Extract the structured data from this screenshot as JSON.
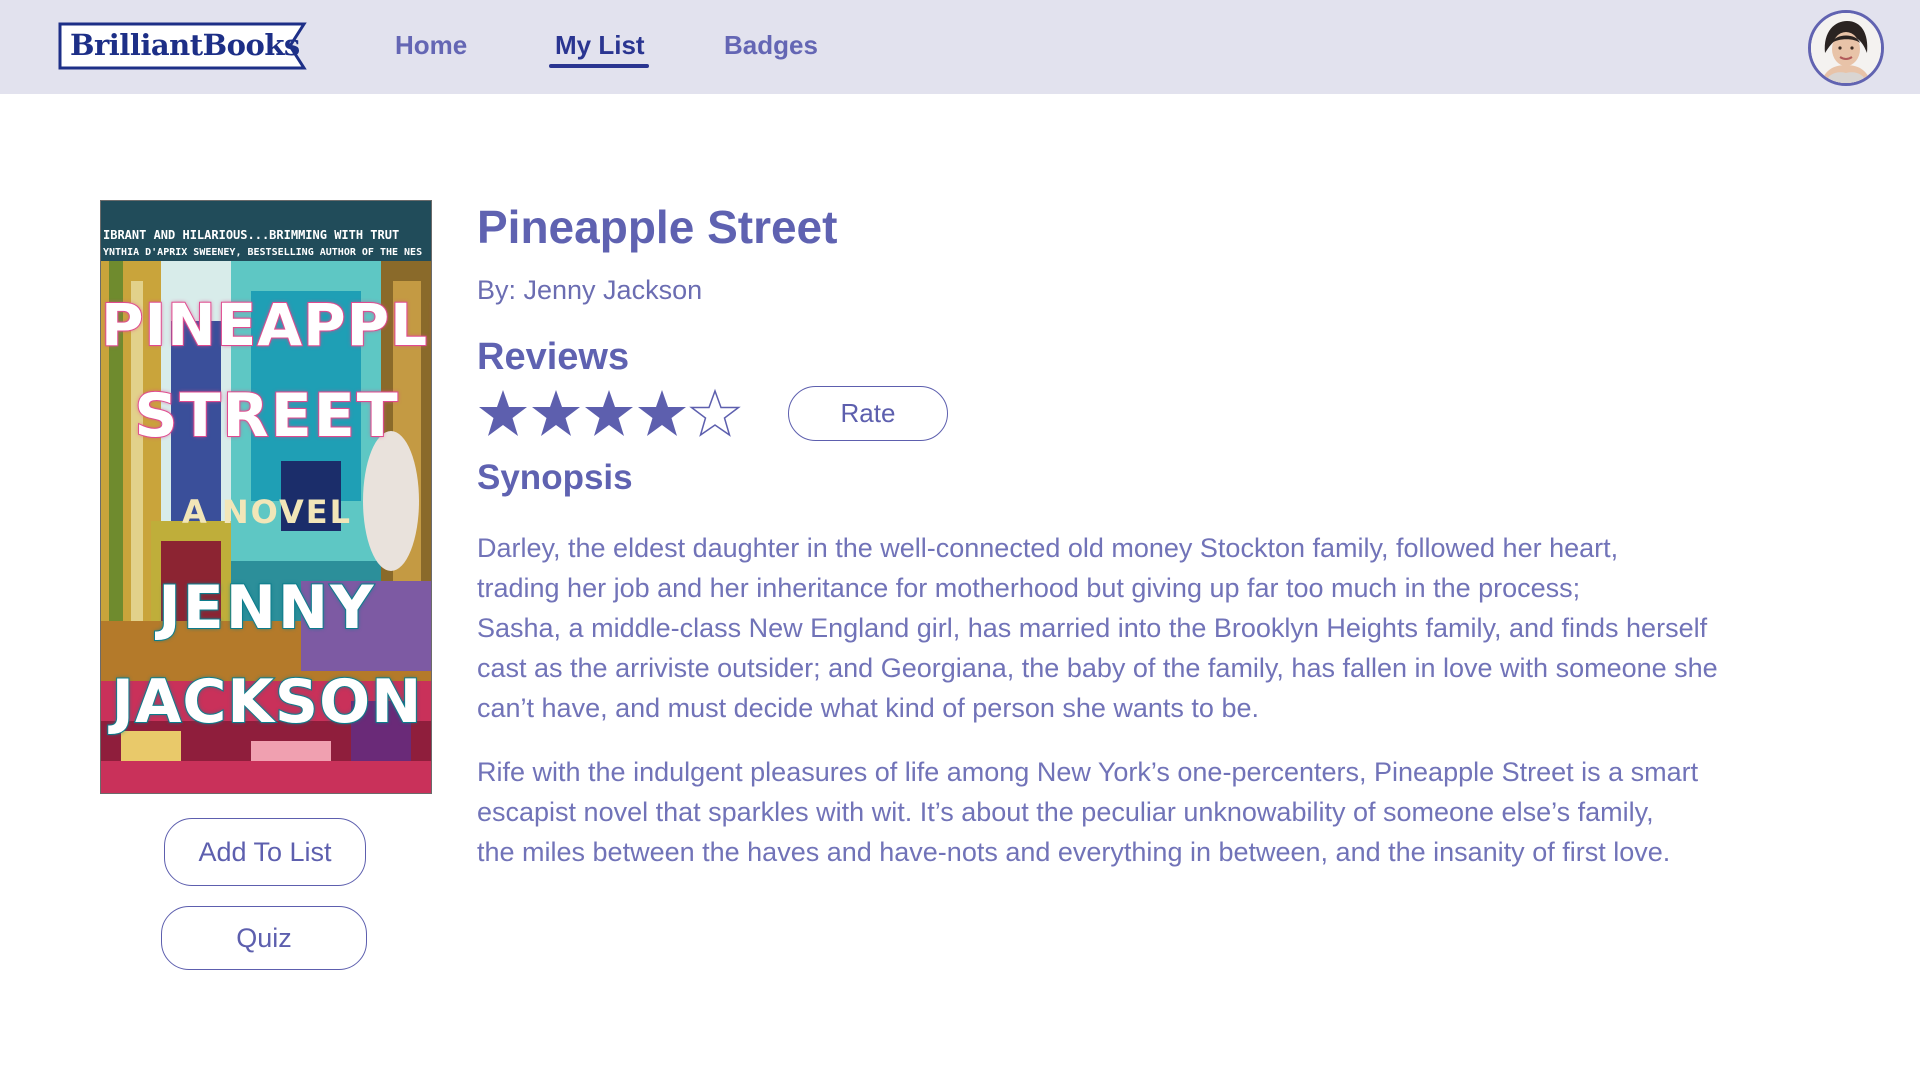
{
  "brand": {
    "name": "BrilliantBooks"
  },
  "nav": {
    "home": "Home",
    "my_list": "My List",
    "badges": "Badges",
    "active": "My List"
  },
  "book": {
    "title": "Pineapple Street",
    "author_line": "By: Jenny Jackson",
    "cover": {
      "tagline_1": "IBRANT AND HILARIOUS...BRIMMING WITH TRUT",
      "tagline_2": "YNTHIA D'APRIX SWEENEY, BESTSELLING AUTHOR OF THE NES",
      "title_1": "PINEAPPLE",
      "title_2": "STREET",
      "subtitle": "A NOVEL",
      "author_1": "JENNY",
      "author_2": "JACKSON"
    }
  },
  "reviews": {
    "heading": "Reviews",
    "rating": 4,
    "max_rating": 5,
    "rate_button": "Rate"
  },
  "synopsis": {
    "heading": "Synopsis",
    "paragraph_1_lines": [
      "Darley, the eldest daughter in the well-connected old money Stockton family, followed her heart,",
      "trading her job and her inheritance for motherhood but giving up far too much in the process;",
      "Sasha, a middle-class New England girl, has married into the Brooklyn Heights family, and finds herself",
      "cast as the arriviste outsider; and Georgiana, the baby of the family, has fallen in love with someone she",
      "can’t have, and must decide what kind of person she wants to be."
    ],
    "paragraph_2_lines": [
      "Rife with the indulgent pleasures of life among New York’s one-percenters, Pineapple Street is a smart",
      "escapist novel that sparkles with wit. It’s about the peculiar unknowability of someone else’s family,",
      "the miles between the haves and have-nots and everything in between, and the insanity of first love."
    ]
  },
  "actions": {
    "add_to_list": "Add To List",
    "quiz": "Quiz"
  },
  "colors": {
    "accent": "#5d5fae",
    "nav_active": "#2a3591",
    "topbar_bg": "#e2e2ee",
    "logo": "#1d2f87"
  },
  "icons": {
    "star_filled": "star-filled-icon",
    "star_empty": "star-outline-icon",
    "avatar": "user-avatar"
  }
}
